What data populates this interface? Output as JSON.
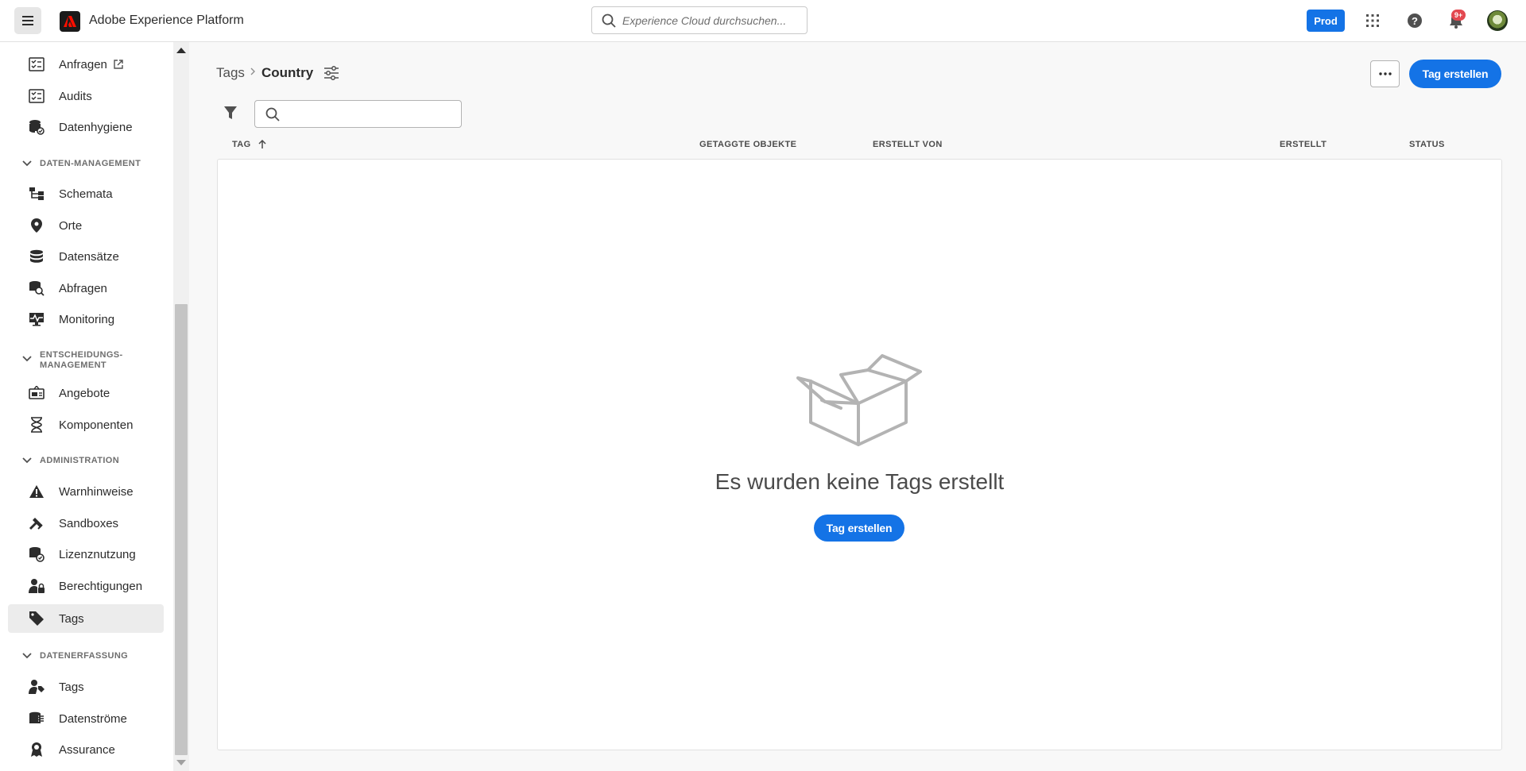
{
  "header": {
    "app_title": "Adobe Experience Platform",
    "search_placeholder": "Experience Cloud durchsuchen...",
    "sandbox_label": "Prod",
    "notification_badge": "9+"
  },
  "sidebar": {
    "items_top": [
      {
        "label": "Anfragen",
        "icon": "checklist-icon"
      },
      {
        "label": "Audits",
        "icon": "checklist-icon"
      },
      {
        "label": "Datenhygiene",
        "icon": "database-hygiene-icon"
      }
    ],
    "sections": [
      {
        "title": "DATEN-MANAGEMENT",
        "items": [
          {
            "label": "Schemata",
            "icon": "schema-icon"
          },
          {
            "label": "Orte",
            "icon": "location-pin-icon"
          },
          {
            "label": "Datensätze",
            "icon": "database-icon"
          },
          {
            "label": "Abfragen",
            "icon": "query-icon"
          },
          {
            "label": "Monitoring",
            "icon": "monitoring-icon"
          }
        ]
      },
      {
        "title_line1": "ENTSCHEIDUNGS-",
        "title_line2": "MANAGEMENT",
        "items": [
          {
            "label": "Angebote",
            "icon": "offers-icon"
          },
          {
            "label": "Komponenten",
            "icon": "components-icon"
          }
        ]
      },
      {
        "title": "ADMINISTRATION",
        "items": [
          {
            "label": "Warnhinweise",
            "icon": "alert-icon"
          },
          {
            "label": "Sandboxes",
            "icon": "sandbox-icon"
          },
          {
            "label": "Lizenznutzung",
            "icon": "license-icon"
          },
          {
            "label": "Berechtigungen",
            "icon": "permissions-icon"
          },
          {
            "label": "Tags",
            "icon": "tag-icon",
            "active": true
          }
        ]
      },
      {
        "title": "DATENERFASSUNG",
        "items": [
          {
            "label": "Tags",
            "icon": "launch-tags-icon"
          },
          {
            "label": "Datenströme",
            "icon": "datastreams-icon"
          },
          {
            "label": "Assurance",
            "icon": "assurance-icon"
          }
        ]
      }
    ]
  },
  "breadcrumb": {
    "parent": "Tags",
    "current": "Country"
  },
  "actions": {
    "create_tag": "Tag erstellen"
  },
  "table": {
    "columns": [
      "TAG",
      "GETAGGTE OBJEKTE",
      "ERSTELLT VON",
      "ERSTELLT",
      "STATUS"
    ]
  },
  "empty_state": {
    "message": "Es wurden keine Tags erstellt",
    "button": "Tag erstellen"
  }
}
